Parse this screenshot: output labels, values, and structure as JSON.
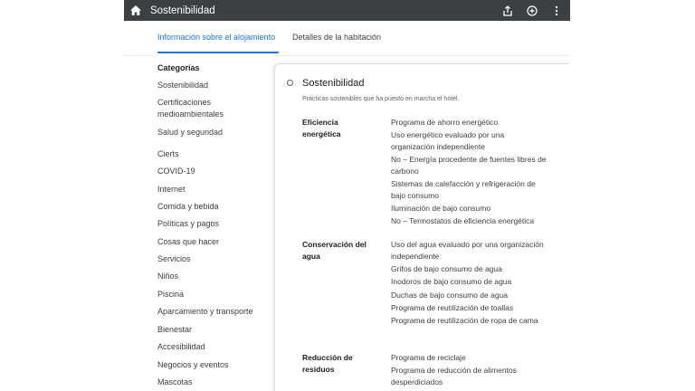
{
  "header": {
    "title": "Sostenibilidad",
    "icons": [
      "home-icon",
      "share-icon",
      "add-circle-icon",
      "more-vert-icon"
    ]
  },
  "tabs": [
    {
      "label": "Información sobre el alojamiento",
      "active": true
    },
    {
      "label": "Detalles de la habitación",
      "active": false
    }
  ],
  "sidebar": {
    "heading": "Categorías",
    "items": [
      "Sostenibilidad",
      "Certificaciones medioambientales",
      "Salud y seguridad",
      "Cierts",
      "COVID-19",
      "Internet",
      "Comida y bebida",
      "Políticas y pagos",
      "Cosas que hacer",
      "Servicios",
      "Niños",
      "Piscina",
      "Aparcamiento y transporte",
      "Bienestar",
      "Accesibilidad",
      "Negocios y eventos",
      "Mascotas"
    ]
  },
  "panel": {
    "title": "Sostenibilidad",
    "subtitle": "Prácticas sostenibles que ha puesto en marcha el hotel.",
    "groups": [
      {
        "title": "Eficiencia energética",
        "items": [
          "Programa de ahorro energético",
          "Uso energético evaluado por una organización independiente",
          "No – Energía procedente de fuentes libres de carbono",
          "Sistemas de calefacción y refrigeración de bajo consumo",
          "Iluminación de bajo consumo",
          "No – Termostatos de eficiencia energética"
        ]
      },
      {
        "title": "Conservación del agua",
        "items": [
          "Uso del agua evaluado por una organización independiente",
          "Grifos de bajo consumo de agua",
          "Inodoros de bajo consumo de agua",
          "Duchas de bajo consumo de agua",
          "Programa de reutilización de toallas",
          "Programa de reutilización de ropa de cama"
        ]
      },
      {
        "title": "Reducción de residuos",
        "items": [
          "Programa de reciclaje",
          "Programa de reducción de alimentos desperdiciados"
        ]
      }
    ]
  },
  "colors": {
    "accent": "#1a73e8",
    "topbar": "#3c4043",
    "text": "#202124",
    "muted": "#5f6368"
  }
}
